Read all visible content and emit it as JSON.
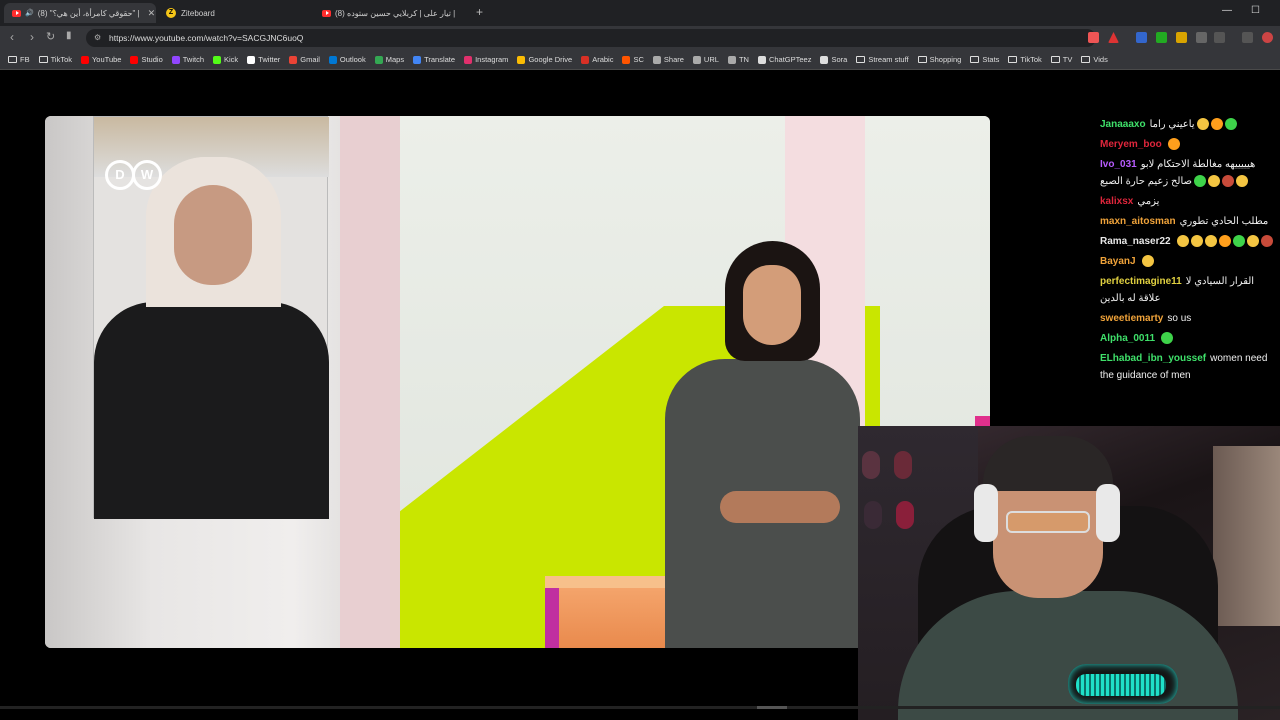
{
  "browser": {
    "tabs": [
      {
        "title": "(8) \"حقوقي كامرأة، أين هي؟\" |",
        "active": true,
        "favicon": "youtube"
      },
      {
        "title": "Ziteboard",
        "active": false,
        "favicon": "ziteboard"
      },
      {
        "title": "(8) تيار على | كربلايي حسين ستوده |",
        "active": false,
        "favicon": "youtube"
      }
    ],
    "url": "https://www.youtube.com/watch?v=SACGJNC6uoQ",
    "bookmarks": [
      {
        "label": "FB",
        "type": "folder"
      },
      {
        "label": "TikTok",
        "type": "folder"
      },
      {
        "label": "YouTube",
        "type": "site",
        "color": "#ff0000"
      },
      {
        "label": "Studio",
        "type": "site",
        "color": "#ff0000"
      },
      {
        "label": "Twitch",
        "type": "site",
        "color": "#9146ff"
      },
      {
        "label": "Kick",
        "type": "site",
        "color": "#53fc18"
      },
      {
        "label": "Twitter",
        "type": "site",
        "color": "#ffffff"
      },
      {
        "label": "Gmail",
        "type": "site",
        "color": "#ea4335"
      },
      {
        "label": "Outlook",
        "type": "site",
        "color": "#0078d4"
      },
      {
        "label": "Maps",
        "type": "site",
        "color": "#34a853"
      },
      {
        "label": "Translate",
        "type": "site",
        "color": "#4285f4"
      },
      {
        "label": "Instagram",
        "type": "site",
        "color": "#e1306c"
      },
      {
        "label": "Google Drive",
        "type": "site",
        "color": "#fbbc04"
      },
      {
        "label": "Arabic",
        "type": "site",
        "color": "#d93025"
      },
      {
        "label": "SC",
        "type": "site",
        "color": "#ff5500"
      },
      {
        "label": "Share",
        "type": "site",
        "color": "#aaaaaa"
      },
      {
        "label": "URL",
        "type": "site",
        "color": "#aaaaaa"
      },
      {
        "label": "TN",
        "type": "site",
        "color": "#aaaaaa"
      },
      {
        "label": "ChatGPTeez",
        "type": "site",
        "color": "#dddddd"
      },
      {
        "label": "Sora",
        "type": "site",
        "color": "#dddddd"
      },
      {
        "label": "Stream stuff",
        "type": "folder"
      },
      {
        "label": "Shopping",
        "type": "folder"
      },
      {
        "label": "Stats",
        "type": "folder"
      },
      {
        "label": "TikTok",
        "type": "folder"
      },
      {
        "label": "TV",
        "type": "folder"
      },
      {
        "label": "Vids",
        "type": "folder"
      }
    ]
  },
  "video": {
    "watermark": "DW"
  },
  "chat": {
    "messages": [
      {
        "user": "Janaaaxo",
        "color": "#3fe06a",
        "text": "ياعيني راما",
        "emotes": 3
      },
      {
        "user": "Meryem_boo",
        "color": "#e0263c",
        "text": "",
        "emotes": 1
      },
      {
        "user": "Ivo_031",
        "color": "#b85cff",
        "text": "هيييييهه مغالطة الاحتكام لابو صالح زعيم حارة الصبع",
        "emotes": 4
      },
      {
        "user": "kalixsx",
        "color": "#e0263c",
        "text": "يزمي",
        "emotes": 0
      },
      {
        "user": "maxn_aitosman",
        "color": "#f0a33a",
        "text": "مطلب الحادي تطوري",
        "emotes": 0
      },
      {
        "user": "Rama_naser22",
        "color": "#e8e8e8",
        "text": "",
        "emotes": 7
      },
      {
        "user": "BayanJ",
        "color": "#f0a33a",
        "text": "",
        "emotes": 1
      },
      {
        "user": "perfectimagine11",
        "color": "#e0d040",
        "text": "القرار السيادي لا علاقة له بالدين",
        "emotes": 0
      },
      {
        "user": "sweetiemarty",
        "color": "#f0a33a",
        "text": "so us",
        "emotes": 0
      },
      {
        "user": "Alpha_0011",
        "color": "#3fe06a",
        "text": "",
        "emotes": 1
      },
      {
        "user": "ELhabad_ibn_youssef",
        "color": "#3fe06a",
        "text": "women need the guidance of men",
        "emotes": 0
      }
    ]
  },
  "colors": {
    "tabbar": "#202124",
    "toolbar": "#35363a",
    "accent_green": "#c9e600"
  }
}
